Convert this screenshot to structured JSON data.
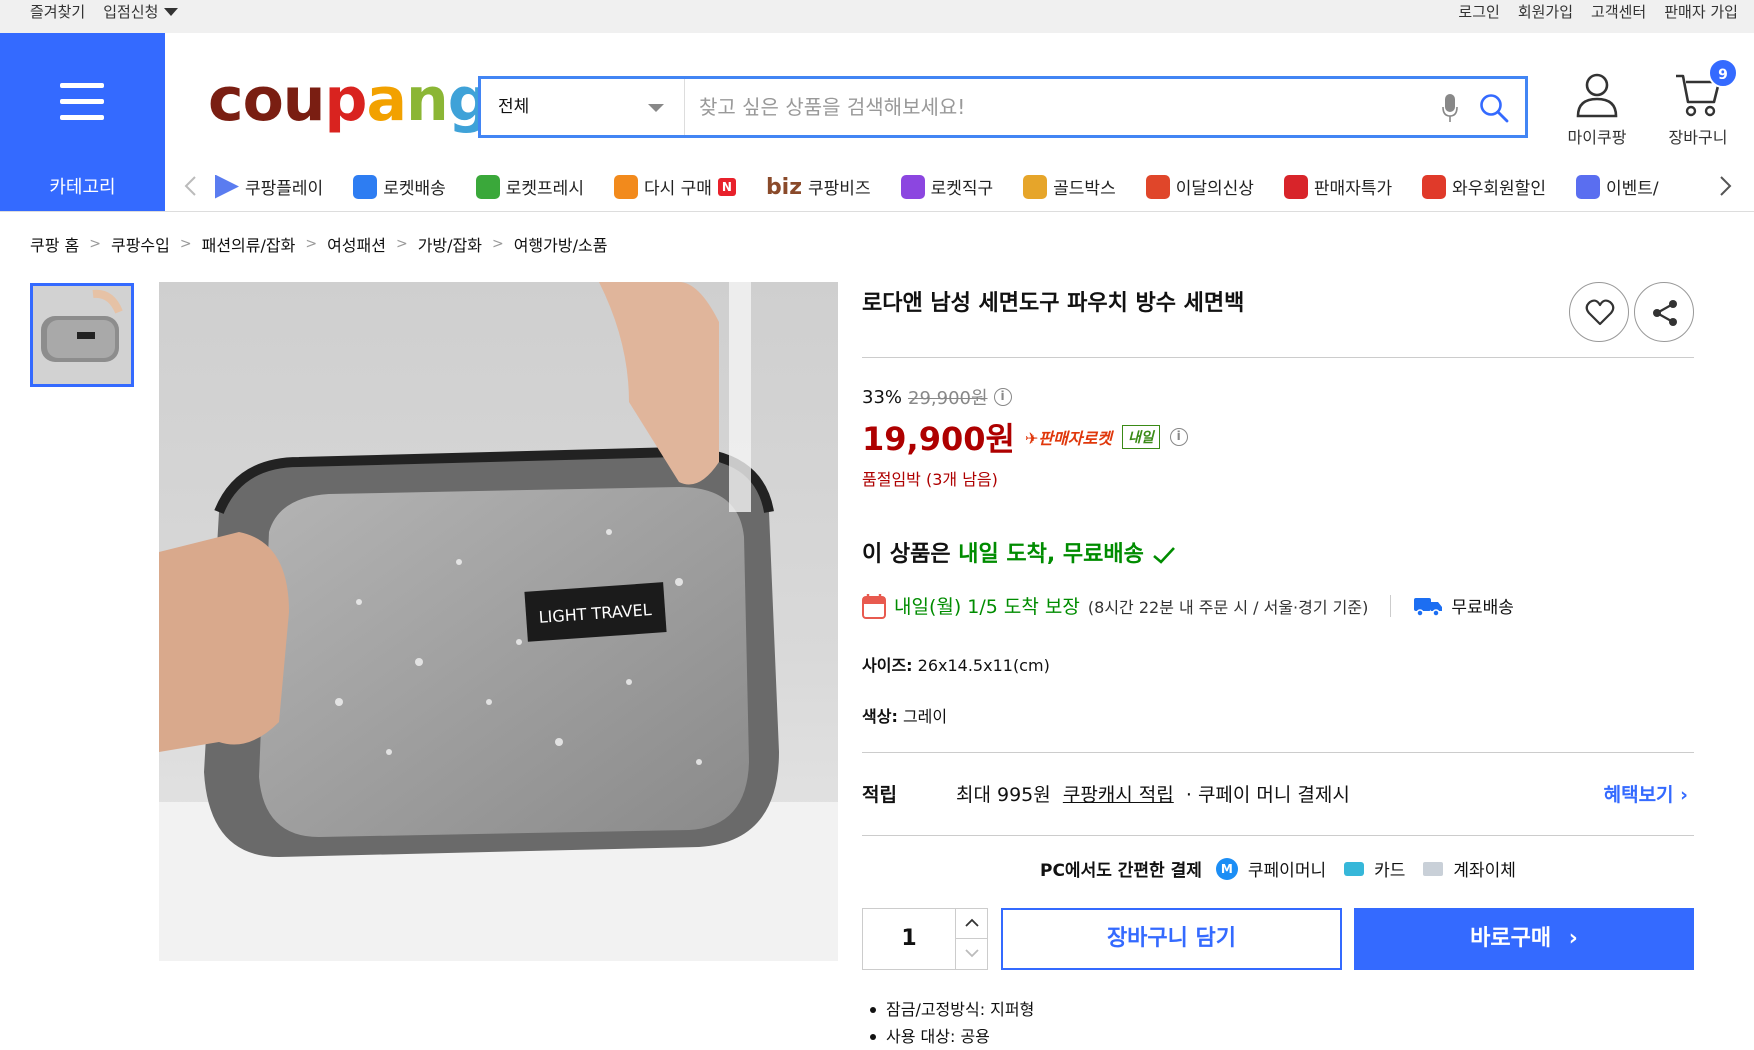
{
  "topbar": {
    "bookmark": "즐겨찾기",
    "seller_apply": "입점신청",
    "login": "로그인",
    "signup": "회원가입",
    "customer_center": "고객센터",
    "seller_signup": "판매자 가입"
  },
  "header": {
    "category_label": "카테고리",
    "logo": {
      "c1": "cou",
      "c2": "p",
      "c3": "a",
      "c4": "n",
      "c5": "g"
    },
    "search_scope": "전체",
    "search_placeholder": "찾고 싶은 상품을 검색해보세요!",
    "mycoupang": "마이쿠팡",
    "cart": "장바구니",
    "cart_count": "9"
  },
  "subnav": [
    {
      "label": "쿠팡플레이",
      "icon": "play-icon",
      "color": "#5a7cf0"
    },
    {
      "label": "로켓배송",
      "icon": "rocket-icon",
      "color": "#2e7df2"
    },
    {
      "label": "로켓프레시",
      "icon": "rocket-fresh-icon",
      "color": "#3aa83a"
    },
    {
      "label": "다시 구매",
      "icon": "basket-icon",
      "color": "#f28a1c"
    },
    {
      "label": "쿠팡비즈",
      "icon": "biz-icon",
      "color": "#8a4a2a"
    },
    {
      "label": "로켓직구",
      "icon": "rocket-global-icon",
      "color": "#8c46e0"
    },
    {
      "label": "골드박스",
      "icon": "goldbox-icon",
      "color": "#e6a52a"
    },
    {
      "label": "이달의신상",
      "icon": "new-bag-icon",
      "color": "#e0462a"
    },
    {
      "label": "판매자특가",
      "icon": "percent-icon",
      "color": "#d8242a"
    },
    {
      "label": "와우회원할인",
      "icon": "wow-icon",
      "color": "#e03a2a"
    },
    {
      "label": "이벤트/",
      "icon": "event-icon",
      "color": "#5a6ef0"
    }
  ],
  "subnav_badge_n": "N",
  "subnav_biz_prefix": "biz",
  "breadcrumb": [
    "쿠팡 홈",
    "쿠팡수입",
    "패션의류/잡화",
    "여성패션",
    "가방/잡화",
    "여행가방/소품"
  ],
  "product": {
    "title": "로다앤 남성 세면도구 파우치 방수 세면백",
    "image_label": "LIGHT TRAVEL",
    "discount_rate": "33%",
    "original_price": "29,900원",
    "sale_price": "19,900원",
    "seller_rocket": "판매자로켓",
    "tomorrow_badge": "내일",
    "stock_notice": "품절임박 (3개 남음)",
    "delivery_head_prefix": "이 상품은 ",
    "delivery_head_green": "내일 도착, 무료배송",
    "delivery_date": "내일(월) 1/5 도착 보장",
    "delivery_condition": "(8시간 22분 내 주문 시 / 서울·경기 기준)",
    "free_shipping": "무료배송",
    "size_label": "사이즈:",
    "size_value": "26x14.5x11(cm)",
    "color_label": "색상:",
    "color_value": "그레이",
    "reward_label": "적립",
    "reward_prefix": "최대 995원",
    "reward_link": "쿠팡캐시 적립",
    "reward_suffix": "· 쿠페이 머니 결제시",
    "reward_more": "혜택보기",
    "pay_head": "PC에서도 간편한 결제",
    "pay_m_icon_text": "M",
    "pay_money": "쿠페이머니",
    "pay_card": "카드",
    "pay_account": "계좌이체",
    "quantity": "1",
    "add_to_cart": "장바구니 담기",
    "buy_now": "바로구매",
    "specs": [
      "잠금/고정방식: 지퍼형",
      "사용 대상: 공용"
    ]
  },
  "colors": {
    "accent": "#346aff",
    "price": "#ae0000",
    "green": "#008c00"
  }
}
